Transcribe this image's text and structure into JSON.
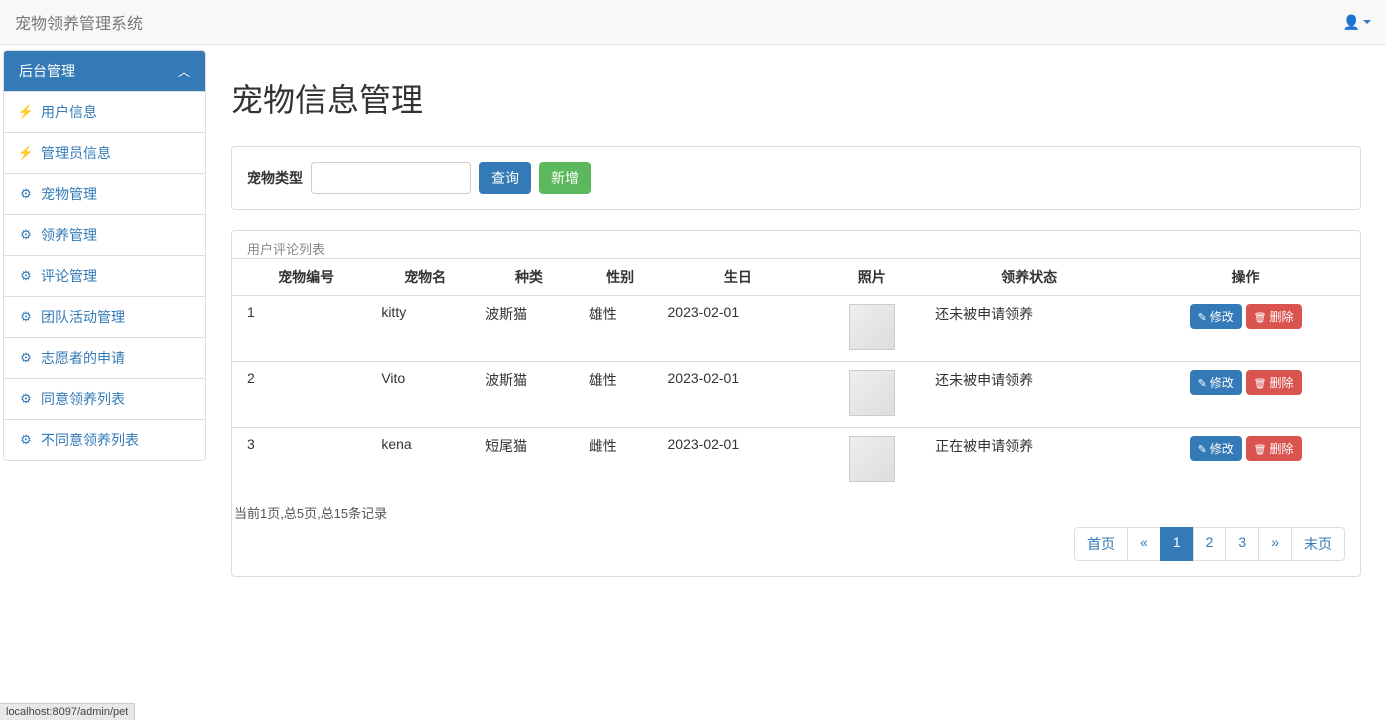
{
  "navbar": {
    "brand": "宠物领养管理系统"
  },
  "sidebar": {
    "heading": "后台管理",
    "items": [
      {
        "icon": "⚡",
        "label": "用户信息"
      },
      {
        "icon": "⚡",
        "label": "管理员信息"
      },
      {
        "icon": "⚙",
        "label": "宠物管理"
      },
      {
        "icon": "⚙",
        "label": "领养管理"
      },
      {
        "icon": "⚙",
        "label": "评论管理"
      },
      {
        "icon": "⚙",
        "label": "团队活动管理"
      },
      {
        "icon": "⚙",
        "label": "志愿者的申请"
      },
      {
        "icon": "⚙",
        "label": "同意领养列表"
      },
      {
        "icon": "⚙",
        "label": "不同意领养列表"
      }
    ]
  },
  "page": {
    "title": "宠物信息管理"
  },
  "search": {
    "label": "宠物类型",
    "query_btn": "查询",
    "add_btn": "新增"
  },
  "table": {
    "legend": "用户评论列表",
    "headers": [
      "宠物编号",
      "宠物名",
      "种类",
      "性别",
      "生日",
      "照片",
      "领养状态",
      "操作"
    ],
    "rows": [
      {
        "id": "1",
        "name": "kitty",
        "breed": "波斯猫",
        "sex": "雄性",
        "birthday": "2023-02-01",
        "status": "还未被申请领养"
      },
      {
        "id": "2",
        "name": "Vito",
        "breed": "波斯猫",
        "sex": "雄性",
        "birthday": "2023-02-01",
        "status": "还未被申请领养"
      },
      {
        "id": "3",
        "name": "kena",
        "breed": "短尾猫",
        "sex": "雌性",
        "birthday": "2023-02-01",
        "status": "正在被申请领养"
      }
    ],
    "edit_label": "修改",
    "delete_label": "删除"
  },
  "pagination": {
    "info": "当前1页,总5页,总15条记录",
    "first": "首页",
    "prev": "«",
    "pages": [
      "1",
      "2",
      "3"
    ],
    "active_page": "1",
    "next": "»",
    "last": "末页"
  },
  "status_bar": "localhost:8097/admin/pet"
}
